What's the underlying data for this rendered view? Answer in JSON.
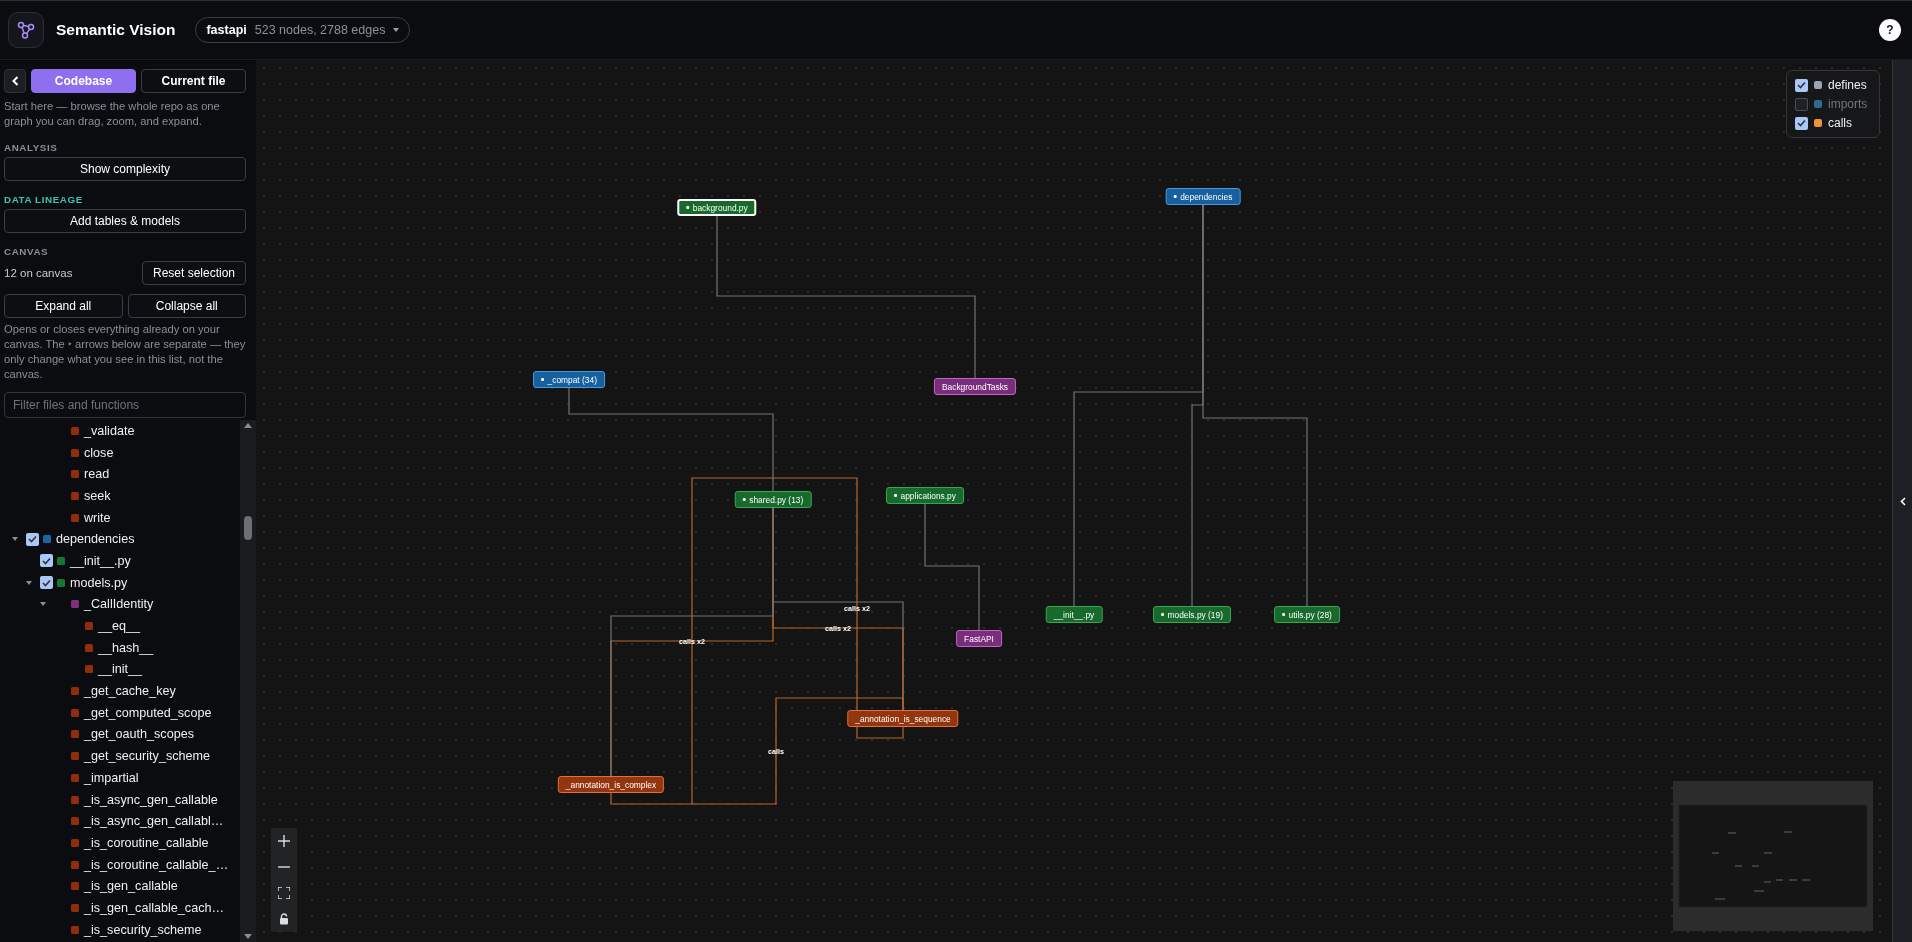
{
  "header": {
    "title": "Semantic Vision",
    "repo": {
      "name": "fastapi",
      "stats": "523 nodes, 2788 edges"
    },
    "help": "?"
  },
  "sidebar": {
    "tabs": [
      {
        "label": "Codebase",
        "selected": true
      },
      {
        "label": "Current file",
        "selected": false
      }
    ],
    "intro": "Start here — browse the whole repo as one graph you can drag, zoom, and expand.",
    "analysis": {
      "heading": "ANALYSIS",
      "button": "Show complexity"
    },
    "lineage": {
      "heading": "DATA LINEAGE",
      "button": "Add tables & models"
    },
    "canvas": {
      "heading": "CANVAS",
      "count": "12 on canvas",
      "reset": "Reset selection",
      "expand": "Expand all",
      "collapse": "Collapse all",
      "note": "Opens or closes everything already on your canvas. The ‣ arrows below are separate — they only change what you see in this list, not the canvas."
    },
    "filter": {
      "placeholder": "Filter files and functions"
    }
  },
  "tree": {
    "scrolled_parent_children": [
      {
        "label": "_validate",
        "kind": "function"
      },
      {
        "label": "close",
        "kind": "function"
      },
      {
        "label": "read",
        "kind": "function"
      },
      {
        "label": "seek",
        "kind": "function"
      },
      {
        "label": "write",
        "kind": "function"
      }
    ],
    "items": [
      {
        "label": "dependencies",
        "kind": "module",
        "checked": true,
        "expanded": true,
        "children": [
          {
            "label": "__init__.py",
            "kind": "file",
            "checked": true
          },
          {
            "label": "models.py",
            "kind": "file",
            "checked": true,
            "expanded": true,
            "children": [
              {
                "label": "_CallIdentity",
                "kind": "class",
                "expanded": true,
                "children": [
                  {
                    "label": "__eq__",
                    "kind": "function"
                  },
                  {
                    "label": "__hash__",
                    "kind": "function"
                  },
                  {
                    "label": "__init__",
                    "kind": "function"
                  }
                ]
              },
              {
                "label": "_get_cache_key",
                "kind": "function"
              },
              {
                "label": "_get_computed_scope",
                "kind": "function"
              },
              {
                "label": "_get_oauth_scopes",
                "kind": "function"
              },
              {
                "label": "_get_security_scheme",
                "kind": "function"
              },
              {
                "label": "_impartial",
                "kind": "function"
              },
              {
                "label": "_is_async_gen_callable",
                "kind": "function"
              },
              {
                "label": "_is_async_gen_callabl…",
                "kind": "function"
              },
              {
                "label": "_is_coroutine_callable",
                "kind": "function"
              },
              {
                "label": "_is_coroutine_callable_…",
                "kind": "function"
              },
              {
                "label": "_is_gen_callable",
                "kind": "function"
              },
              {
                "label": "_is_gen_callable_cach…",
                "kind": "function"
              },
              {
                "label": "_is_security_scheme",
                "kind": "function"
              }
            ]
          }
        ]
      }
    ]
  },
  "legend": {
    "items": [
      {
        "label": "defines",
        "checked": true,
        "color": "#9aa3b2"
      },
      {
        "label": "imports",
        "checked": false,
        "color": "#2f6b8a"
      },
      {
        "label": "calls",
        "checked": true,
        "color": "#f0923a"
      }
    ]
  },
  "graph": {
    "nodes": [
      {
        "label": "background.py",
        "kind": "file",
        "expandable": true,
        "selected": true
      },
      {
        "label": "dependencies",
        "kind": "module",
        "expandable": true,
        "selected": false
      },
      {
        "label": "_compat (34)",
        "kind": "module",
        "expandable": true,
        "selected": false
      },
      {
        "label": "BackgroundTasks",
        "kind": "class",
        "expandable": false,
        "selected": false
      },
      {
        "label": "shared.py (13)",
        "kind": "file",
        "expandable": true,
        "selected": false
      },
      {
        "label": "applications.py",
        "kind": "file",
        "expandable": true,
        "selected": false
      },
      {
        "label": "FastAPI",
        "kind": "class",
        "expandable": false,
        "selected": false
      },
      {
        "label": "_annotation_is_sequence",
        "kind": "function",
        "expandable": false,
        "selected": false
      },
      {
        "label": "_annotation_is_complex",
        "kind": "function",
        "expandable": false,
        "selected": false
      },
      {
        "label": "__init__.py",
        "kind": "file",
        "expandable": false,
        "selected": false
      },
      {
        "label": "models.py (19)",
        "kind": "file",
        "expandable": true,
        "selected": false
      },
      {
        "label": "utils.py (28)",
        "kind": "file",
        "expandable": true,
        "selected": false
      }
    ],
    "edges": [
      {
        "kind": "defines"
      },
      {
        "kind": "defines"
      },
      {
        "kind": "defines"
      },
      {
        "kind": "defines"
      },
      {
        "kind": "defines"
      },
      {
        "kind": "defines"
      },
      {
        "kind": "defines",
        "label": "calls x2"
      },
      {
        "kind": "calls",
        "label": "calls x2"
      },
      {
        "kind": "calls",
        "label": "calls x2"
      },
      {
        "kind": "defines"
      },
      {
        "kind": "calls"
      },
      {
        "kind": "calls",
        "label": "calls"
      }
    ]
  }
}
